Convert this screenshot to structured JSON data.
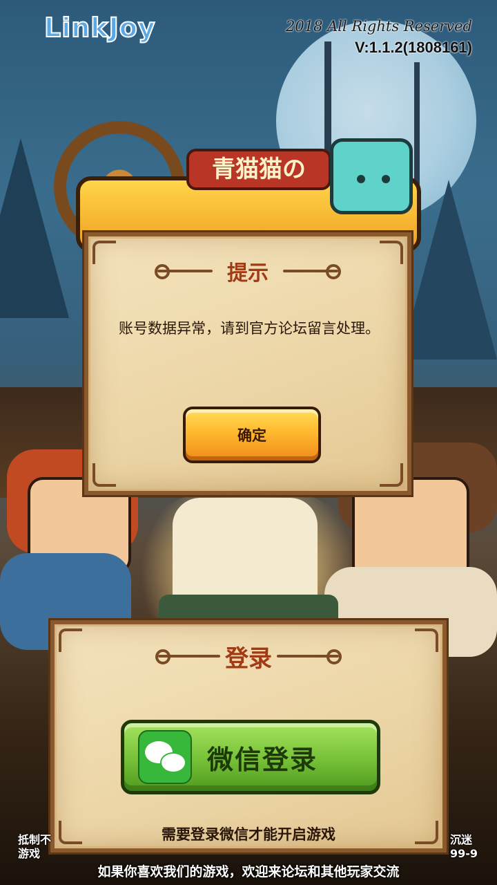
{
  "header": {
    "brand": "LinkJoy",
    "rights": "2018 All Rights Reserved",
    "version": "V:1.1.2(1808161)"
  },
  "game_title": {
    "sign_text": "青猫猫の"
  },
  "alert_dialog": {
    "title": "提示",
    "message": "账号数据异常，请到官方论坛留言处理。",
    "ok_label": "确定"
  },
  "login_panel": {
    "title": "登录",
    "wechat_label": "微信登录",
    "note": "需要登录微信才能开启游戏"
  },
  "side_text": {
    "left_line1": "抵制不",
    "left_line2": "游戏",
    "right_line1": "沉迷",
    "right_line2": "99-9"
  },
  "footer": {
    "text": "如果你喜欢我们的游戏，欢迎来论坛和其他玩家交流"
  },
  "colors": {
    "panel_border": "#8a5a2e",
    "title_red": "#a23a14",
    "ok_button": "#ffb92e",
    "wechat_green": "#79c43a"
  },
  "icons": [
    "wechat-icon",
    "ship-wheel-icon",
    "cat-mascot-icon"
  ]
}
